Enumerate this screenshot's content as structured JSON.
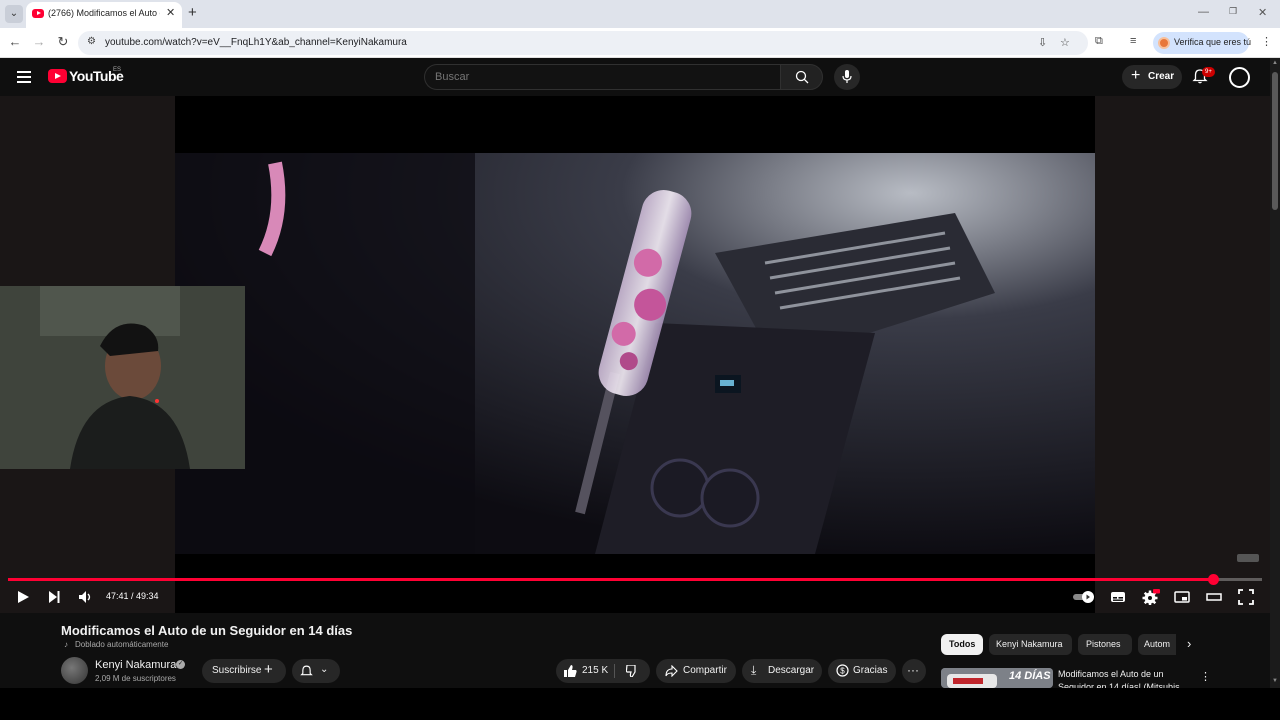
{
  "browser": {
    "tab_title": "(2766) Modificamos el Auto de",
    "url": "youtube.com/watch?v=eV__FnqLh1Y&ab_channel=KenyiNakamura",
    "profile_label": "Verifica que eres tú"
  },
  "header": {
    "logo_text": "YouTube",
    "country_code": "ES",
    "search_placeholder": "Buscar",
    "create_label": "Crear",
    "notification_count": "9+"
  },
  "player": {
    "current_time": "47:41",
    "duration": "49:34",
    "time_display": "47:41 / 49:34",
    "progress": 0.961,
    "settings_badge": "HD"
  },
  "video": {
    "title": "Modificamos el Auto de un Seguidor en 14 días",
    "dub_note": "Doblado automáticamente",
    "channel_name": "Kenyi Nakamura",
    "subscriber_count": "2,09 M de suscriptores",
    "subscribe_label": "Suscribirse",
    "like_count": "215 K",
    "share_label": "Compartir",
    "download_label": "Descargar",
    "thanks_label": "Gracias"
  },
  "recommendations": {
    "chips": [
      "Todos",
      "Kenyi Nakamura",
      "Pistones",
      "Autom"
    ],
    "items": [
      {
        "title": "Modificamos el Auto de un Seguidor en 14 días! (Mitsubis",
        "thumb_text": "14 DÍAS"
      }
    ]
  },
  "colors": {
    "accent": "#ff0033",
    "background": "#0f0f0f",
    "pill": "#272727"
  }
}
